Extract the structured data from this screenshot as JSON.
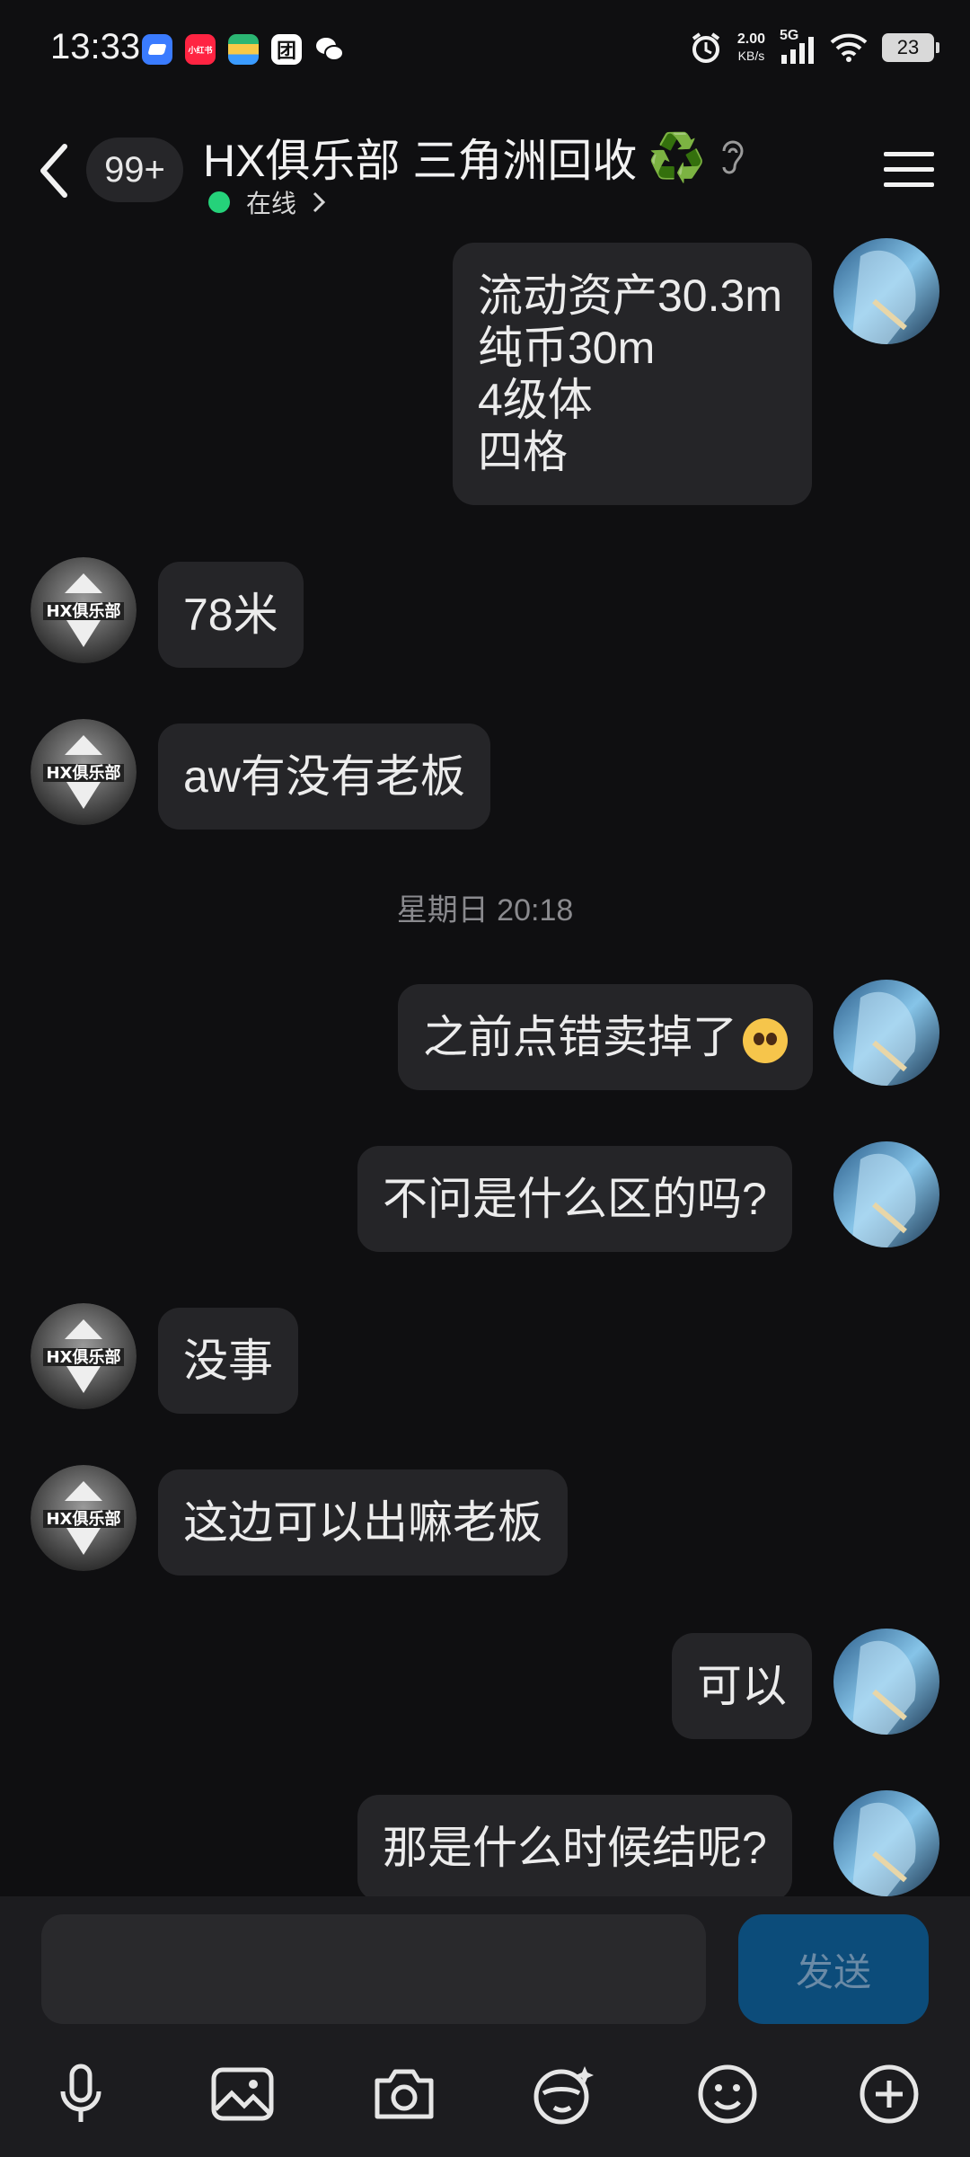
{
  "status_bar": {
    "time": "13:33",
    "net_speed_value": "2.00",
    "net_speed_unit": "KB/s",
    "network": "5G",
    "battery": "23",
    "app_icons": [
      {
        "name": "app-blue-icon",
        "color": "#3a7bff",
        "label": ""
      },
      {
        "name": "xiaohongshu-icon",
        "color": "#ff2442",
        "label": "小红书"
      },
      {
        "name": "app-multicolor-icon",
        "color": "#2bb673",
        "label": ""
      },
      {
        "name": "app-tuan-icon",
        "color": "#ffffff",
        "label": "团"
      },
      {
        "name": "wechat-icon",
        "color": "#ffffff",
        "label": ""
      }
    ]
  },
  "header": {
    "unread_badge": "99+",
    "title": "HX俱乐部 三角洲回收",
    "recycle_emoji": "♻️",
    "status": "在线"
  },
  "chat": {
    "timestamp": "星期日 20:18",
    "messages": [
      {
        "side": "right",
        "lines": [
          "流动资产30.3m",
          "纯币30m",
          "4级体",
          "四格"
        ]
      },
      {
        "side": "left",
        "lines": [
          "78米"
        ]
      },
      {
        "side": "left",
        "lines": [
          "aw有没有老板"
        ]
      },
      {
        "side": "right",
        "lines": [
          "之前点错卖掉了"
        ]
      },
      {
        "side": "right",
        "lines": [
          "不问是什么区的吗?"
        ]
      },
      {
        "side": "left",
        "lines": [
          "没事"
        ]
      },
      {
        "side": "left",
        "lines": [
          "这边可以出嘛老板"
        ]
      },
      {
        "side": "right",
        "lines": [
          "可以"
        ]
      },
      {
        "side": "right",
        "lines": [
          "那是什么时候结呢?"
        ]
      }
    ]
  },
  "input": {
    "placeholder": "",
    "value": "",
    "send_label": "发送"
  },
  "toolbar": [
    "microphone-icon",
    "image-icon",
    "camera-icon",
    "sticker-icon",
    "emoji-icon",
    "plus-icon"
  ],
  "colors": {
    "background": "#0f0f11",
    "bubble": "#252528",
    "online": "#25d27a",
    "send_button": "#0c4c7a"
  }
}
